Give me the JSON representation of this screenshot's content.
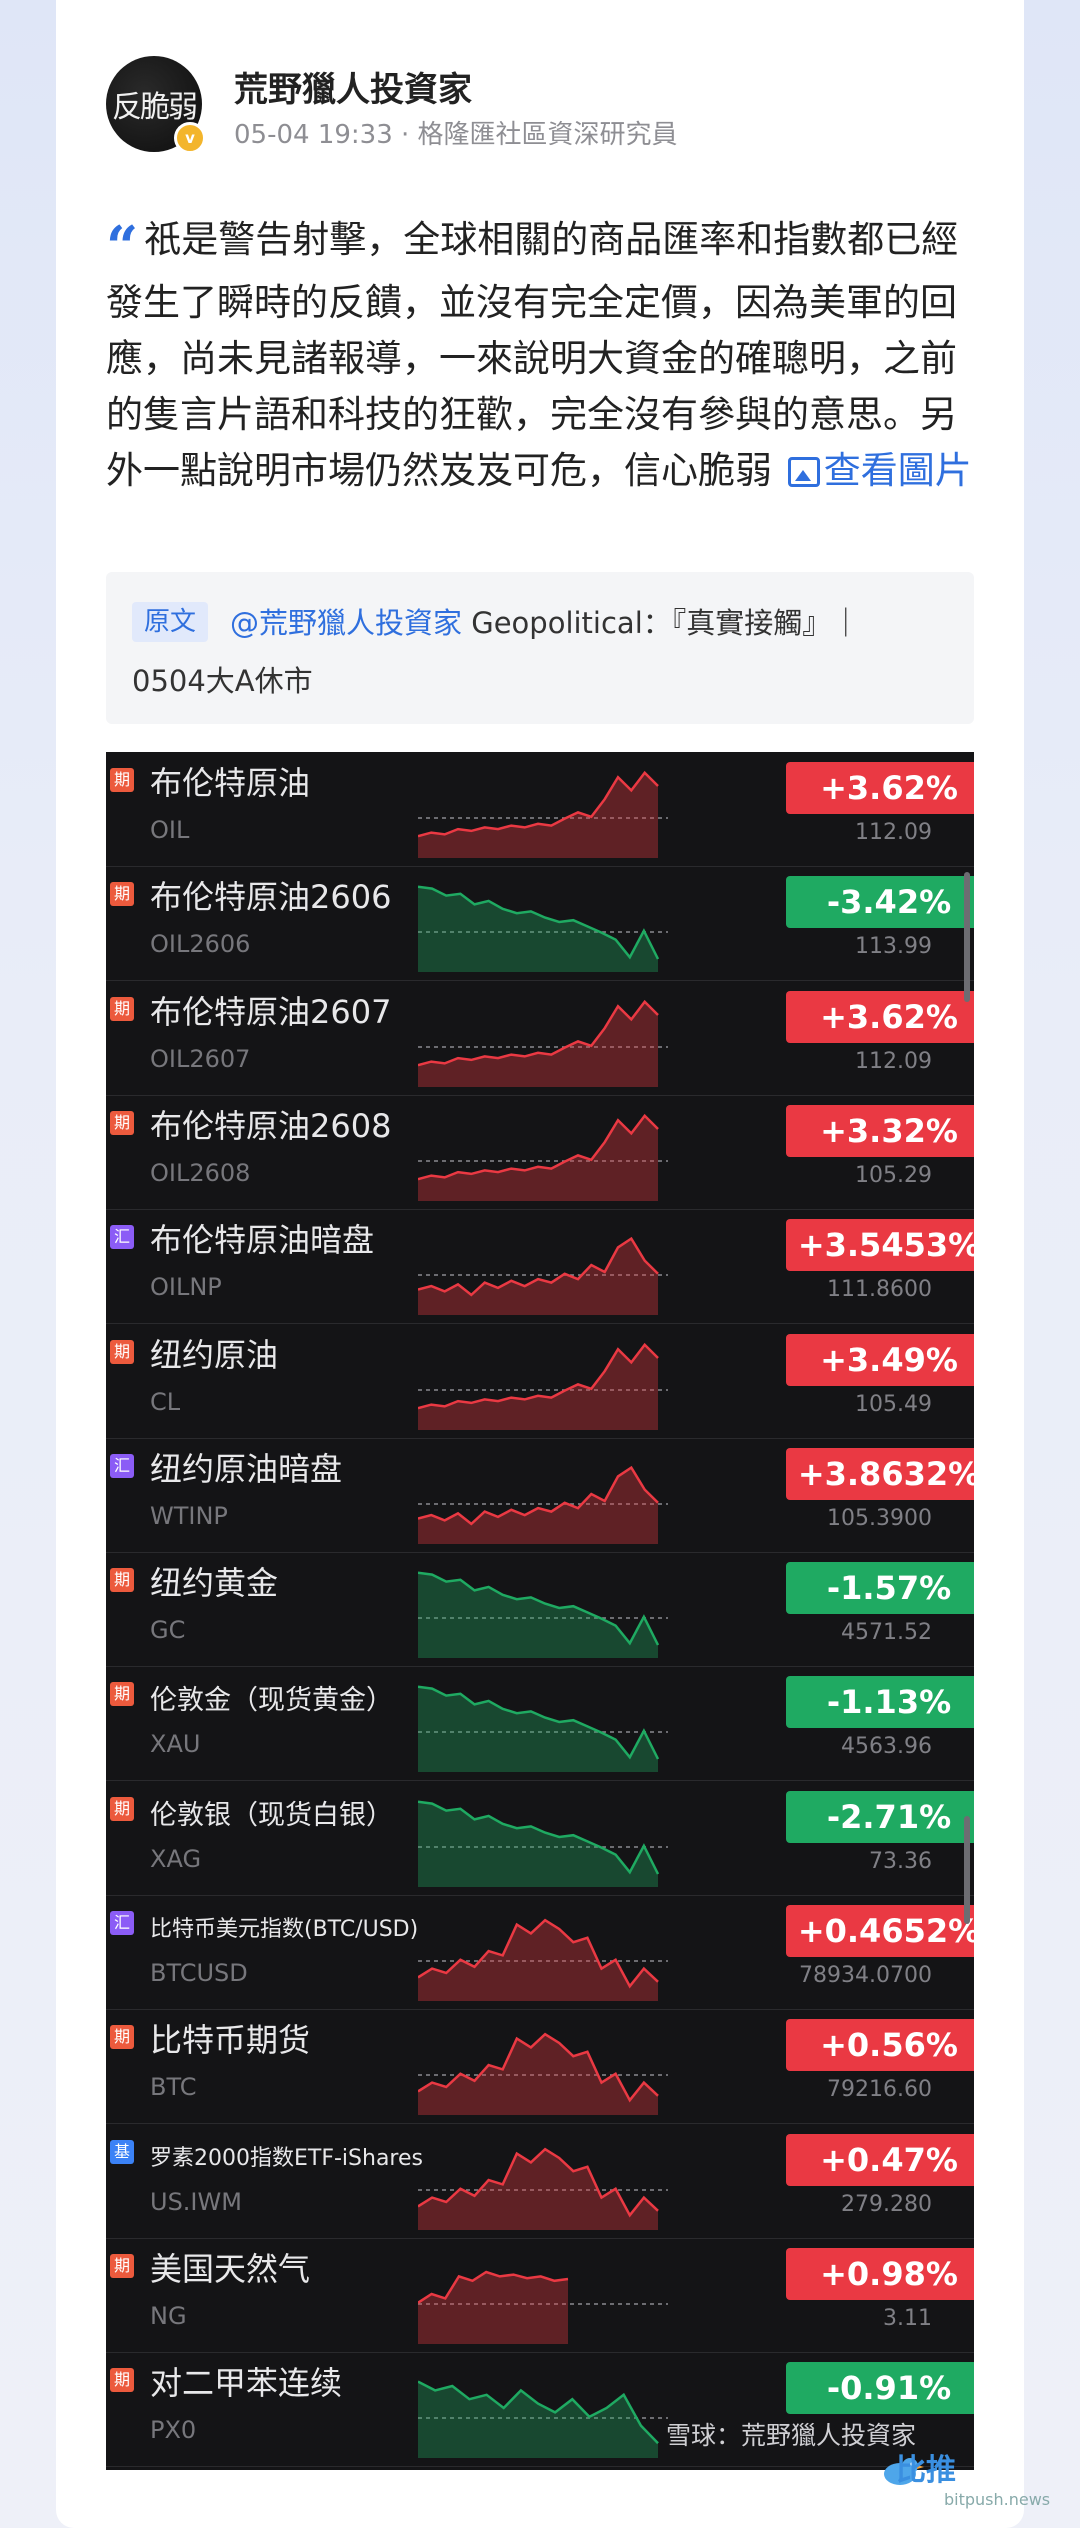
{
  "post": {
    "author": "荒野獵人投資家",
    "avatar_text": "反脆弱",
    "avatar_badge": "v",
    "timestamp": "05-04 19:33",
    "separator": " · ",
    "author_title": "格隆匯社區資深研究員",
    "quote_icon": "quote-icon",
    "body": "祇是警告射擊，全球相關的商品匯率和指數都已經發生了瞬時的反饋，並沒有完全定價，因為美軍的回應，尚未見諸報導，一來說明大資金的確聰明，之前的隻言片語和科技的狂歡，完全沒有參與的意思。另外一點說明市場仍然岌岌可危，信心脆弱",
    "view_image_label": "查看圖片",
    "original_tag": "原文",
    "original_mention": "@荒野獵人投資家",
    "original_title": " Geopolitical：『真實接觸』｜",
    "original_subtitle": "0504大A休市"
  },
  "quotes": [
    {
      "tag": "期",
      "tag_type": "t1",
      "name": "布伦特原油",
      "code": "OIL",
      "change": "+3.62%",
      "price": "112.09",
      "dir": "up"
    },
    {
      "tag": "期",
      "tag_type": "t1",
      "name": "布伦特原油2606",
      "code": "OIL2606",
      "change": "-3.42%",
      "price": "113.99",
      "dir": "down"
    },
    {
      "tag": "期",
      "tag_type": "t1",
      "name": "布伦特原油2607",
      "code": "OIL2607",
      "change": "+3.62%",
      "price": "112.09",
      "dir": "up"
    },
    {
      "tag": "期",
      "tag_type": "t1",
      "name": "布伦特原油2608",
      "code": "OIL2608",
      "change": "+3.32%",
      "price": "105.29",
      "dir": "up"
    },
    {
      "tag": "汇",
      "tag_type": "t2",
      "name": "布伦特原油暗盘",
      "code": "OILNP",
      "change": "+3.5453%",
      "price": "111.8600",
      "dir": "up"
    },
    {
      "tag": "期",
      "tag_type": "t1",
      "name": "纽约原油",
      "code": "CL",
      "change": "+3.49%",
      "price": "105.49",
      "dir": "up"
    },
    {
      "tag": "汇",
      "tag_type": "t2",
      "name": "纽约原油暗盘",
      "code": "WTINP",
      "change": "+3.8632%",
      "price": "105.3900",
      "dir": "up"
    },
    {
      "tag": "期",
      "tag_type": "t1",
      "name": "纽约黄金",
      "code": "GC",
      "change": "-1.57%",
      "price": "4571.52",
      "dir": "down"
    },
    {
      "tag": "期",
      "tag_type": "t1",
      "name": "伦敦金（现货黄金）",
      "code": "XAU",
      "change": "-1.13%",
      "price": "4563.96",
      "dir": "down",
      "size": "mid"
    },
    {
      "tag": "期",
      "tag_type": "t1",
      "name": "伦敦银（现货白银）",
      "code": "XAG",
      "change": "-2.71%",
      "price": "73.36",
      "dir": "down",
      "size": "mid"
    },
    {
      "tag": "汇",
      "tag_type": "t2",
      "name": "比特币美元指数(BTC/USD)",
      "code": "BTCUSD",
      "change": "+0.4652%",
      "price": "78934.0700",
      "dir": "up",
      "size": "small"
    },
    {
      "tag": "期",
      "tag_type": "t1",
      "name": "比特币期货",
      "code": "BTC",
      "change": "+0.56%",
      "price": "79216.60",
      "dir": "up"
    },
    {
      "tag": "基",
      "tag_type": "t3",
      "name": "罗素2000指数ETF-iShares",
      "code": "US.IWM",
      "change": "+0.47%",
      "price": "279.280",
      "dir": "up",
      "size": "small"
    },
    {
      "tag": "期",
      "tag_type": "t1",
      "name": "美国天然气",
      "code": "NG",
      "change": "+0.98%",
      "price": "3.11",
      "dir": "up"
    },
    {
      "tag": "期",
      "tag_type": "t1",
      "name": "对二甲苯连续",
      "code": "PX0",
      "change": "-0.91%",
      "price": "",
      "dir": "down"
    }
  ],
  "watermark": "雪球：荒野獵人投資家",
  "site_brand": "比推",
  "site_url": "bitpush.news",
  "colors": {
    "up": "#ea3943",
    "down": "#1faa62",
    "link": "#2f6fde"
  }
}
